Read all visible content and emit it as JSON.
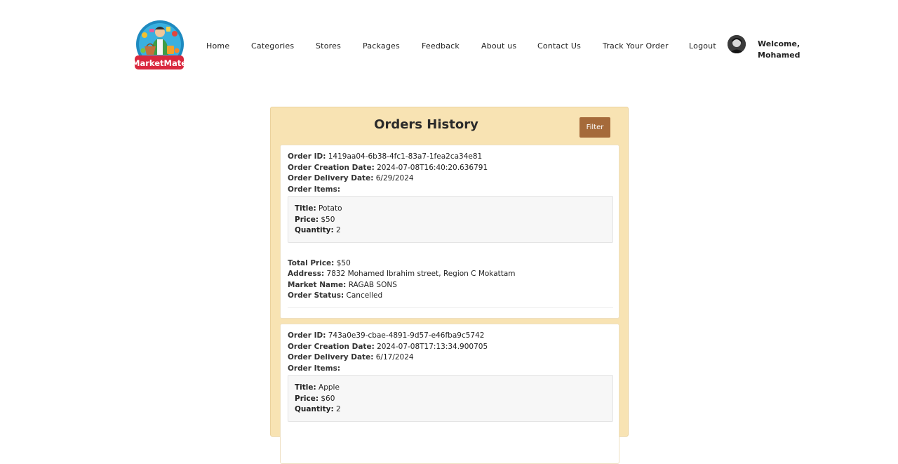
{
  "nav": {
    "brand": "MarketMate",
    "links": [
      "Home",
      "Categories",
      "Stores",
      "Packages",
      "Feedback",
      "About us",
      "Contact Us",
      "Track Your Order",
      "Logout"
    ],
    "welcome_line1": "Welcome,",
    "welcome_line2": "Mohamed"
  },
  "history": {
    "title": "Orders History",
    "filter_label": "Filter",
    "labels": {
      "order_id": "Order ID:",
      "creation_date": "Order Creation Date:",
      "delivery_date": "Order Delivery Date:",
      "items": "Order Items:",
      "title": "Title:",
      "price": "Price:",
      "quantity": "Quantity:",
      "total": "Total Price:",
      "address": "Address:",
      "market": "Market Name:",
      "status": "Order Status:"
    },
    "orders": [
      {
        "id": "1419aa04-6b38-4fc1-83a7-1fea2ca34e81",
        "creation_date": "2024-07-08T16:40:20.636791",
        "delivery_date": "6/29/2024",
        "items": [
          {
            "title": "Potato",
            "price": "$50",
            "quantity": "2"
          }
        ],
        "total": "$50",
        "address": "7832 Mohamed Ibrahim street, Region C Mokattam",
        "market": "RAGAB SONS",
        "status": "Cancelled"
      },
      {
        "id": "743a0e39-cbae-4891-9d57-e46fba9c5742",
        "creation_date": "2024-07-08T17:13:34.900705",
        "delivery_date": "6/17/2024",
        "items": [
          {
            "title": "Apple",
            "price": "$60",
            "quantity": "2"
          }
        ]
      }
    ]
  },
  "colors": {
    "panel": "#f8e3b3",
    "filter_button": "#a56a3a",
    "logo_badge": "#d9283e",
    "logo_circle": "#2ea4d6"
  }
}
